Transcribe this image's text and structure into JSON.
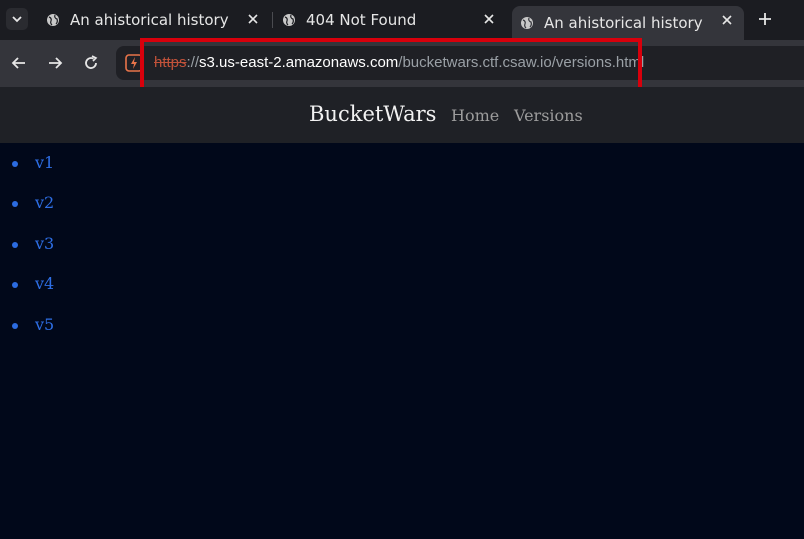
{
  "browser": {
    "tabs": [
      {
        "title": "An ahistorical history",
        "active": false
      },
      {
        "title": "404 Not Found",
        "active": false
      },
      {
        "title": "An ahistorical history",
        "active": true
      }
    ],
    "url": {
      "scheme": "https",
      "separator": "://",
      "host": "s3.us-east-2.amazonaws.com",
      "path": "/bucketwars.ctf.csaw.io/versions.html"
    },
    "highlight_color": "#d8000c"
  },
  "site": {
    "brand": "BucketWars",
    "nav": {
      "home": "Home",
      "versions": "Versions"
    },
    "versions": [
      "v1",
      "v2",
      "v3",
      "v4",
      "v5"
    ],
    "link_color": "#2e6fe6",
    "background": "#01081a"
  }
}
